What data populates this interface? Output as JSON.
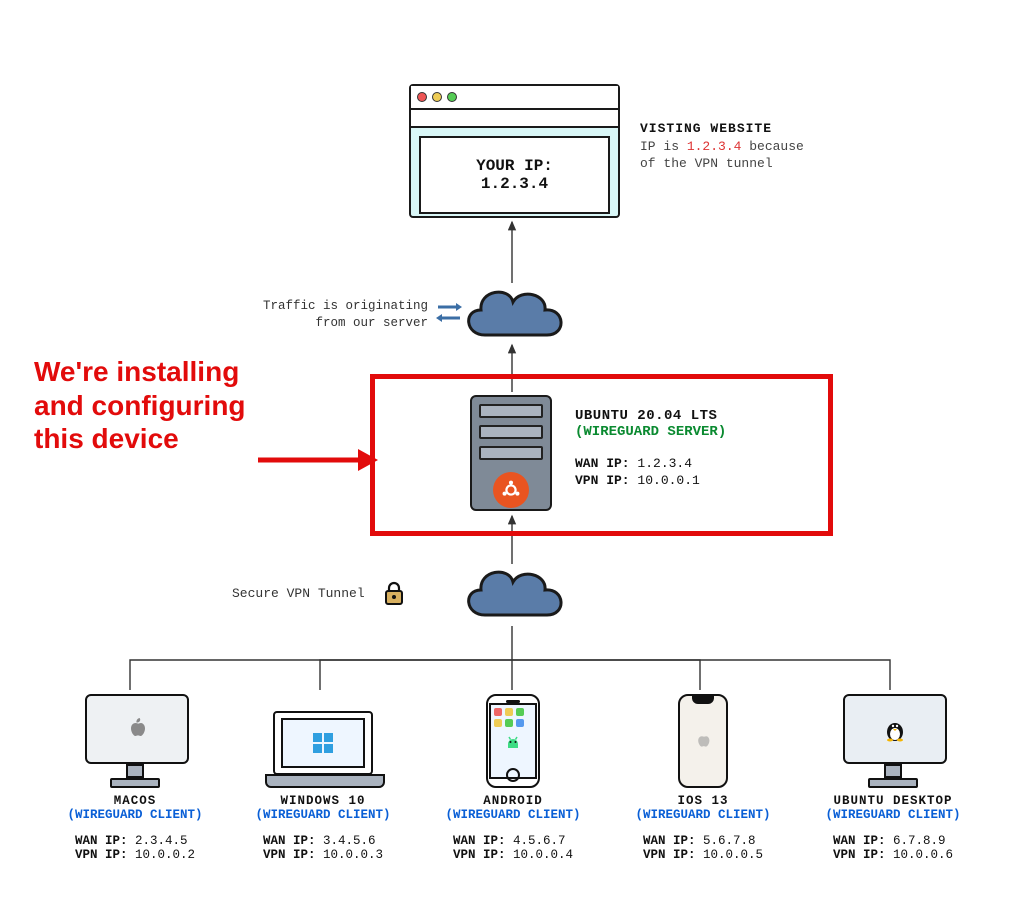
{
  "colors": {
    "accent_red": "#e20b0b",
    "link_blue": "#0a5fd6",
    "role_green": "#0a8a30",
    "cloud": "#5a7ca8"
  },
  "browser": {
    "line1": "YOUR IP:",
    "line2": "1.2.3.4"
  },
  "website_caption": {
    "title": "VISTING WEBSITE",
    "part_a": "IP is ",
    "ip": "1.2.3.4",
    "part_b": " because",
    "line3": "of the VPN tunnel"
  },
  "origin_label": {
    "line1": "Traffic is originating",
    "line2": "from our server"
  },
  "server": {
    "os": "UBUNTU 20.04 LTS",
    "role": "(WIREGUARD SERVER)",
    "wan_label": "WAN IP:",
    "wan_ip": "1.2.3.4",
    "vpn_label": "VPN IP:",
    "vpn_ip": "10.0.0.1"
  },
  "callout": {
    "line1": "We're installing",
    "line2": "and configuring",
    "line3": "this device"
  },
  "tunnel_label": "Secure VPN Tunnel",
  "clients": [
    {
      "name": "MACOS",
      "role": "(WIREGUARD CLIENT)",
      "wan_label": "WAN IP:",
      "wan_ip": "2.3.4.5",
      "vpn_label": "VPN IP:",
      "vpn_ip": "10.0.0.2"
    },
    {
      "name": "WINDOWS 10",
      "role": "(WIREGUARD CLIENT)",
      "wan_label": "WAN IP:",
      "wan_ip": "3.4.5.6",
      "vpn_label": "VPN IP:",
      "vpn_ip": "10.0.0.3"
    },
    {
      "name": "ANDROID",
      "role": "(WIREGUARD CLIENT)",
      "wan_label": "WAN IP:",
      "wan_ip": "4.5.6.7",
      "vpn_label": "VPN IP:",
      "vpn_ip": "10.0.0.4"
    },
    {
      "name": "IOS 13",
      "role": "(WIREGUARD CLIENT)",
      "wan_label": "WAN IP:",
      "wan_ip": "5.6.7.8",
      "vpn_label": "VPN IP:",
      "vpn_ip": "10.0.0.5"
    },
    {
      "name": "UBUNTU DESKTOP",
      "role": "(WIREGUARD CLIENT)",
      "wan_label": "WAN IP:",
      "wan_ip": "6.7.8.9",
      "vpn_label": "VPN IP:",
      "vpn_ip": "10.0.0.6"
    }
  ]
}
